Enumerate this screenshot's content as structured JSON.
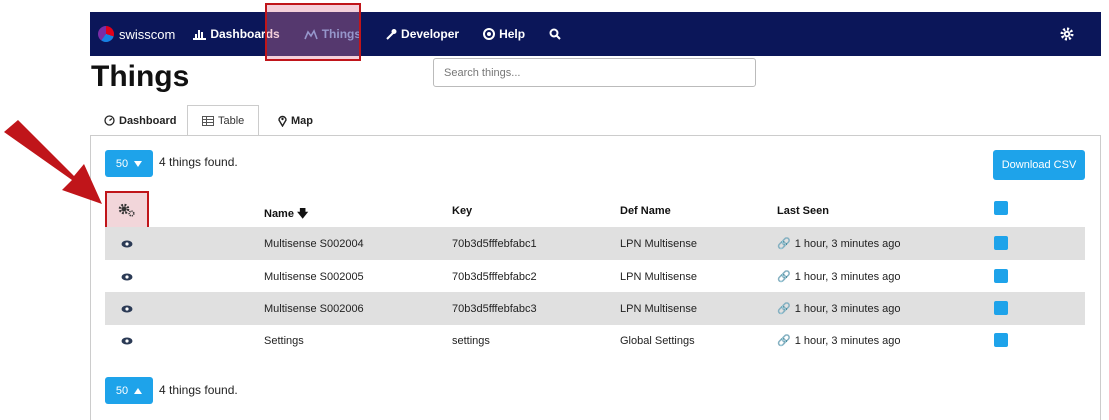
{
  "nav": {
    "brand": "swisscom",
    "items": [
      {
        "label": "Dashboards",
        "icon": "bar-chart-icon"
      },
      {
        "label": "Things",
        "icon": "things-icon"
      },
      {
        "label": "Developer",
        "icon": "wrench-icon"
      },
      {
        "label": "Help",
        "icon": "lifebuoy-icon"
      }
    ]
  },
  "page": {
    "title": "Things"
  },
  "search": {
    "placeholder": "Search things..."
  },
  "tabs": [
    {
      "label": "Dashboard",
      "icon": "dashboard-icon"
    },
    {
      "label": "Table",
      "icon": "table-icon"
    },
    {
      "label": "Map",
      "icon": "map-pin-icon"
    }
  ],
  "pager_top": {
    "value": "50",
    "found": "4 things found."
  },
  "pager_bottom": {
    "value": "50",
    "found": "4 things found."
  },
  "download_label": "Download CSV",
  "table": {
    "headers": {
      "name": "Name",
      "key": "Key",
      "def": "Def Name",
      "last": "Last Seen"
    },
    "rows": [
      {
        "name": "Multisense S002004",
        "key": "70b3d5fffebfabc1",
        "def": "LPN Multisense",
        "last": "1 hour, 3 minutes ago"
      },
      {
        "name": "Multisense S002005",
        "key": "70b3d5fffebfabc2",
        "def": "LPN Multisense",
        "last": "1 hour, 3 minutes ago"
      },
      {
        "name": "Multisense S002006",
        "key": "70b3d5fffebfabc3",
        "def": "LPN Multisense",
        "last": "1 hour, 3 minutes ago"
      },
      {
        "name": "Settings",
        "key": "settings",
        "def": "Global Settings",
        "last": "1 hour, 3 minutes ago"
      }
    ]
  },
  "colors": {
    "navbar": "#0b1659",
    "accent": "#1ea3ea",
    "highlight": "#c0151a"
  }
}
